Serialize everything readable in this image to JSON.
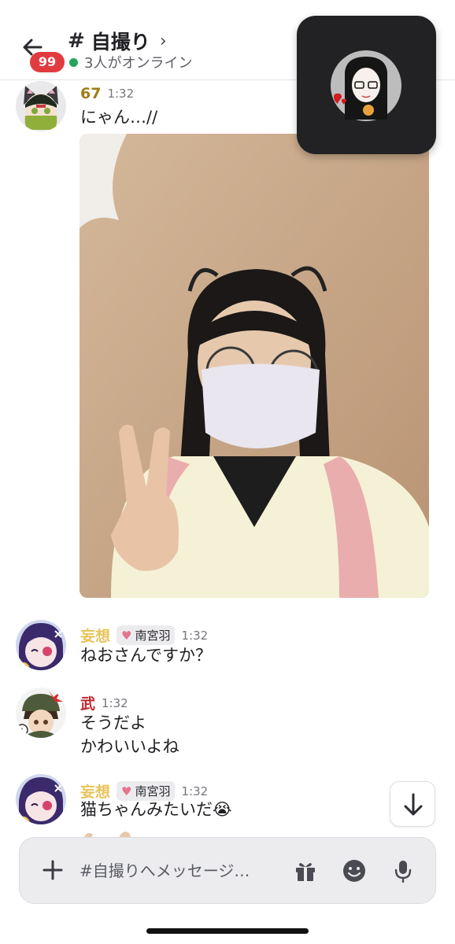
{
  "header": {
    "back_icon": "arrow-left-icon",
    "unread_badge": "99",
    "hash": "#",
    "channel_name": "自撮り",
    "chevron": "›",
    "online_text": "3人がオンライン",
    "online_color": "#23a55a"
  },
  "call_window": {
    "avatar_icon": "caller-avatar"
  },
  "messages": [
    {
      "username": "67",
      "username_color": "#a07d17",
      "time": "1:32",
      "lines": [
        "にゃん…//"
      ],
      "has_photo": true
    },
    {
      "username": "妄想",
      "username_color": "#e7c35a",
      "role": "南宮羽",
      "time": "1:32",
      "lines": [
        "ねおさんですか？"
      ]
    },
    {
      "username": "武",
      "username_color": "#c0262d",
      "time": "1:32",
      "lines": [
        "そうだよ",
        "かわいいよね"
      ]
    },
    {
      "username": "妄想",
      "username_color": "#e7c35a",
      "role": "南宮羽",
      "time": "1:32",
      "lines": [
        "猫ちゃんみたいだ😭"
      ]
    }
  ],
  "scroll_button_icon": "arrow-down-icon",
  "composer": {
    "placeholder": "#自撮りへメッセージ…",
    "icons": [
      "plus-icon",
      "gift-icon",
      "emoji-icon",
      "microphone-icon"
    ]
  }
}
